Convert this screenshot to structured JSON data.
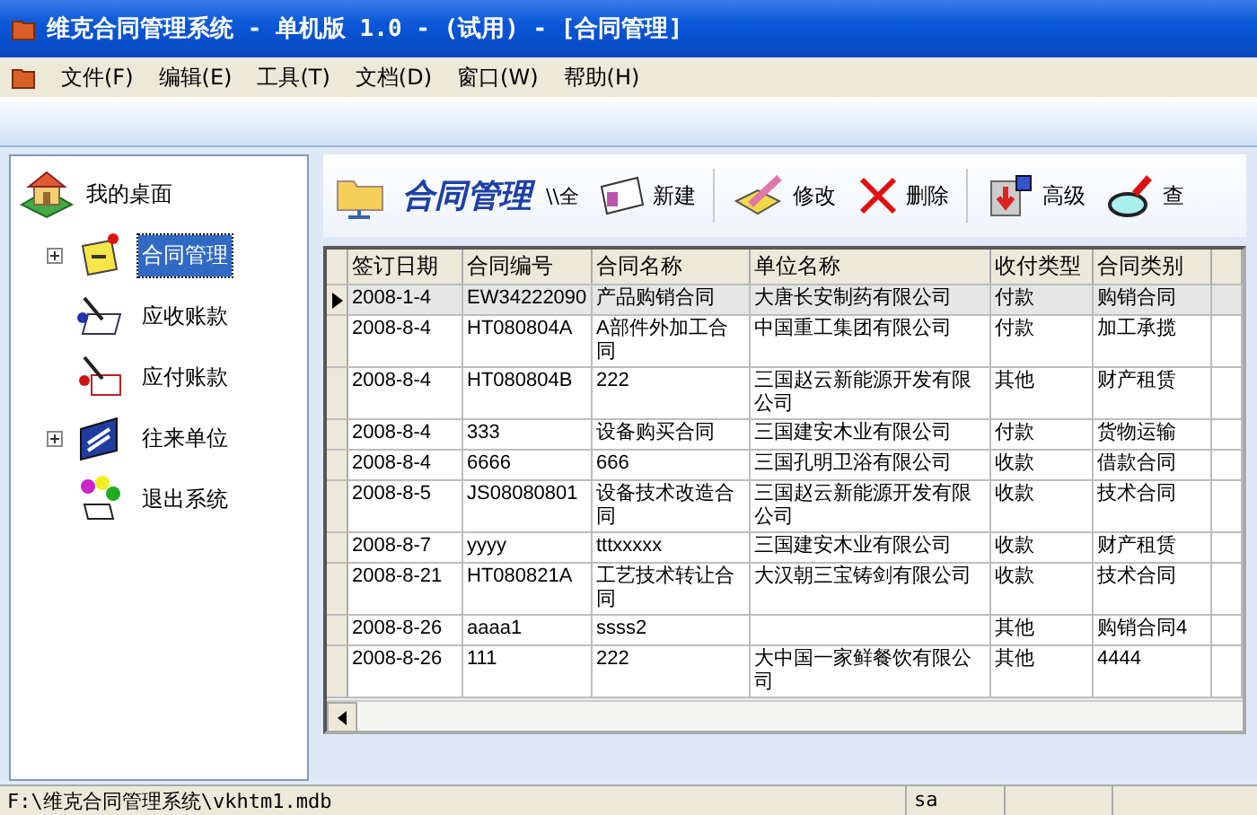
{
  "window": {
    "title": "维克合同管理系统 - 单机版 1.0 - (试用) - [合同管理]"
  },
  "menu": [
    "文件(F)",
    "编辑(E)",
    "工具(T)",
    "文档(D)",
    "窗口(W)",
    "帮助(H)"
  ],
  "sidebar": {
    "root": "我的桌面",
    "items": [
      {
        "label": "合同管理",
        "expandable": true,
        "selected": true
      },
      {
        "label": "应收账款",
        "expandable": false,
        "selected": false
      },
      {
        "label": "应付账款",
        "expandable": false,
        "selected": false
      },
      {
        "label": "往来单位",
        "expandable": true,
        "selected": false
      },
      {
        "label": "退出系统",
        "expandable": false,
        "selected": false
      }
    ]
  },
  "toolbar": {
    "title": "合同管理",
    "overlap_text": "\\\\全",
    "buttons": [
      "新建",
      "修改",
      "删除",
      "高级",
      "查"
    ]
  },
  "table": {
    "columns": [
      "签订日期",
      "合同编号",
      "合同名称",
      "单位名称",
      "收付类型",
      "合同类别"
    ],
    "rows": [
      {
        "selected": true,
        "cells": [
          "2008-1-4",
          "EW34222090",
          "产品购销合同",
          "大唐长安制药有限公司",
          "付款",
          "购销合同"
        ]
      },
      {
        "selected": false,
        "cells": [
          "2008-8-4",
          "HT080804A",
          "A部件外加工合同",
          "中国重工集团有限公司",
          "付款",
          "加工承揽"
        ]
      },
      {
        "selected": false,
        "cells": [
          "2008-8-4",
          "HT080804B",
          "222",
          "三国赵云新能源开发有限公司",
          "其他",
          "财产租赁"
        ]
      },
      {
        "selected": false,
        "cells": [
          "2008-8-4",
          "333",
          "设备购买合同",
          "三国建安木业有限公司",
          "付款",
          "货物运输"
        ]
      },
      {
        "selected": false,
        "cells": [
          "2008-8-4",
          "6666",
          "666",
          "三国孔明卫浴有限公司",
          "收款",
          "借款合同"
        ]
      },
      {
        "selected": false,
        "cells": [
          "2008-8-5",
          "JS08080801",
          "设备技术改造合同",
          "三国赵云新能源开发有限公司",
          "收款",
          "技术合同"
        ]
      },
      {
        "selected": false,
        "cells": [
          "2008-8-7",
          "yyyy",
          "tttxxxxx",
          "三国建安木业有限公司",
          "收款",
          "财产租赁"
        ]
      },
      {
        "selected": false,
        "cells": [
          "2008-8-21",
          "HT080821A",
          "工艺技术转让合同",
          "大汉朝三宝铸剑有限公司",
          "收款",
          "技术合同"
        ]
      },
      {
        "selected": false,
        "cells": [
          "2008-8-26",
          "aaaa1",
          "ssss2",
          "",
          "其他",
          "购销合同4"
        ]
      },
      {
        "selected": false,
        "cells": [
          "2008-8-26",
          "111",
          "222",
          "大中国一家鲜餐饮有限公司",
          "其他",
          "4444"
        ]
      }
    ]
  },
  "status_bar": [
    "F:\\维克合同管理系统\\vkhtm1.mdb",
    "sa"
  ]
}
